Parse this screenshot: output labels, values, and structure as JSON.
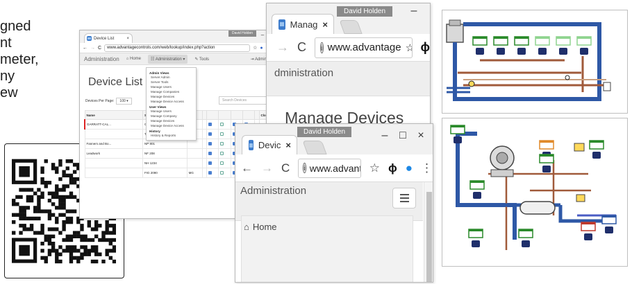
{
  "intro": {
    "lines": [
      "gned",
      "nt",
      "meter,",
      "ny",
      "ew"
    ]
  },
  "qr": {
    "icon": "qr-code-icon"
  },
  "window1": {
    "tab_title": "Device List",
    "user": "David Holden",
    "url": "www.advantagecontrols.com/web/lookup/index.php?action",
    "nav": {
      "brand": "Administration",
      "home": "Home",
      "admin_menu": "Administration",
      "tools": "Tools",
      "logout": "Admin Logout"
    },
    "menu": {
      "groups": [
        {
          "title": "Admin Views",
          "items": [
            "Server Admin",
            "Server Tools",
            "Manage Users",
            "Manage Companies",
            "Manage Devices",
            "Manage Device Access"
          ]
        },
        {
          "title": "User Views",
          "items": [
            "Manage Users",
            "Manage Company",
            "Manage Devices",
            "Manage Device Access"
          ]
        },
        {
          "title": "History",
          "items": [
            "History & Reports"
          ]
        }
      ]
    },
    "page_title": "Device List",
    "per_page_label": "Devices Per Page:",
    "per_page_value": "100",
    "search_placeholder": "Search Devices",
    "columns": [
      "Name",
      "Serial #",
      "",
      "",
      "",
      "",
      "",
      "",
      "",
      "Clone"
    ],
    "rows": [
      [
        "GARRATT-CAL...",
        "G0152A0L10",
        "",
        "",
        "",
        "",
        "",
        "",
        "",
        ""
      ],
      [
        "",
        "TB 4000",
        "",
        "",
        "",
        "",
        "",
        "",
        "",
        ""
      ],
      [
        "Fanners and Bo...",
        "NP 801",
        "",
        "",
        "",
        "",
        "",
        "",
        "",
        ""
      ],
      [
        "Leadwork",
        "NF 208",
        "",
        "",
        "",
        "",
        "",
        "",
        "",
        ""
      ],
      [
        "",
        "NH 1234",
        "",
        "",
        "",
        "",
        "",
        "",
        "",
        ""
      ],
      [
        "",
        "FIG 2090",
        "MG",
        "",
        "",
        "",
        "",
        "",
        "",
        ""
      ]
    ]
  },
  "window2": {
    "tab_title": "Manag",
    "user": "David Holden",
    "url": "www.advantage",
    "app_label": "dministration",
    "big_title": "Manage Devices"
  },
  "window3": {
    "tab_title": "Devic",
    "user": "David Holden",
    "url": "www.advanta",
    "app_label": "Administration",
    "home_label": "Home"
  },
  "diagram": {
    "icon": "process-diagram-icon"
  }
}
